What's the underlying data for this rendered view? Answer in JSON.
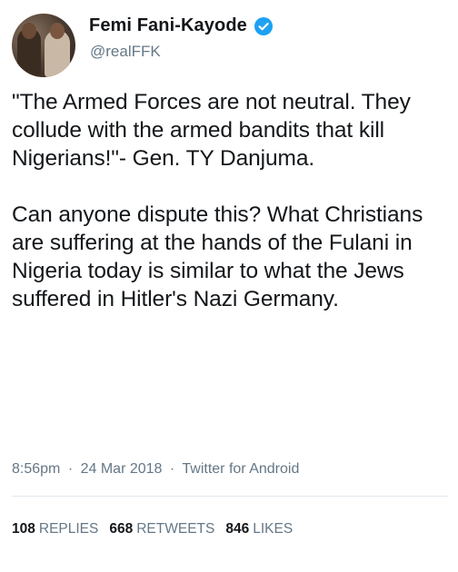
{
  "author": {
    "display_name": "Femi Fani-Kayode",
    "handle": "@realFFK",
    "verified": true,
    "avatar_icon": "profile-photo"
  },
  "tweet": {
    "paragraphs": [
      "\"The Armed Forces are not neutral. They collude with the armed bandits that kill Nigerians!\"- Gen. TY Danjuma.",
      "Can anyone dispute this? What Christians are suffering at the hands of the Fulani in Nigeria today is similar to what the Jews suffered in Hitler's Nazi Germany."
    ]
  },
  "meta": {
    "time": "8:56pm",
    "date": "24 Mar 2018",
    "source": "Twitter for Android",
    "separator": "·"
  },
  "stats": {
    "replies_count": "108",
    "replies_label": "REPLIES",
    "retweets_count": "668",
    "retweets_label": "RETWEETS",
    "likes_count": "846",
    "likes_label": "LIKES"
  },
  "colors": {
    "text": "#14171a",
    "secondary": "#657786",
    "verified_blue": "#1da1f2",
    "divider": "#e1e8ed"
  }
}
